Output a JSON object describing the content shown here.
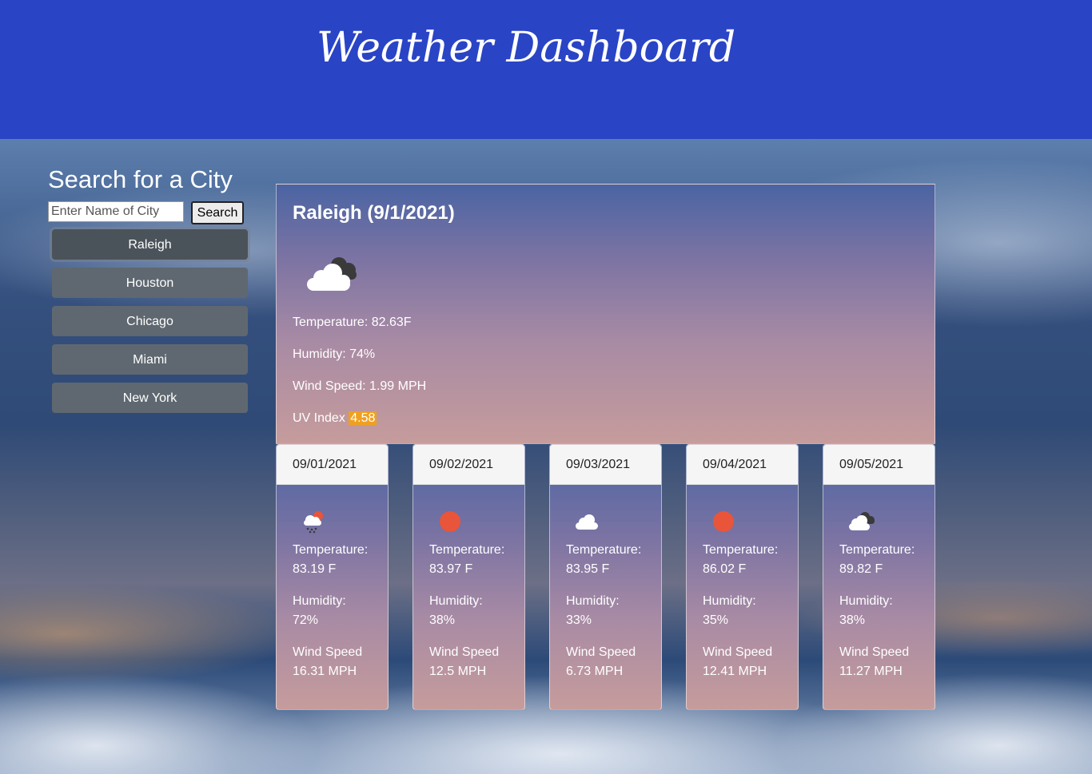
{
  "header": {
    "title": "Weather Dashboard"
  },
  "search": {
    "title": "Search for a City",
    "placeholder": "Enter Name of City",
    "button_label": "Search"
  },
  "cities": [
    "Raleigh",
    "Houston",
    "Chicago",
    "Miami",
    "New York"
  ],
  "current": {
    "heading": "Raleigh (9/1/2021)",
    "icon": "broken-clouds-icon",
    "temperature": "Temperature: 82.63F",
    "humidity": "Humidity: 74%",
    "wind": "Wind Speed: 1.99 MPH",
    "uv_label": "UV Index",
    "uv_value": "4.58",
    "uv_color": "#f0a020"
  },
  "forecast": [
    {
      "date": "09/01/2021",
      "icon": "rain-snow-icon",
      "temp_label": "Temperature:",
      "temp": "83.19 F",
      "hum_label": "Humidity:",
      "hum": "72%",
      "wind_label": "Wind Speed",
      "wind": "16.31 MPH"
    },
    {
      "date": "09/02/2021",
      "icon": "sun-icon",
      "temp_label": "Temperature:",
      "temp": "83.97 F",
      "hum_label": "Humidity:",
      "hum": "38%",
      "wind_label": "Wind Speed",
      "wind": "12.5 MPH"
    },
    {
      "date": "09/03/2021",
      "icon": "cloud-icon",
      "temp_label": "Temperature:",
      "temp": "83.95 F",
      "hum_label": "Humidity:",
      "hum": "33%",
      "wind_label": "Wind Speed",
      "wind": "6.73 MPH"
    },
    {
      "date": "09/04/2021",
      "icon": "sun-icon",
      "temp_label": "Temperature:",
      "temp": "86.02 F",
      "hum_label": "Humidity:",
      "hum": "35%",
      "wind_label": "Wind Speed",
      "wind": "12.41 MPH"
    },
    {
      "date": "09/05/2021",
      "icon": "broken-clouds-icon",
      "temp_label": "Temperature:",
      "temp": "89.82 F",
      "hum_label": "Humidity:",
      "hum": "38%",
      "wind_label": "Wind Speed",
      "wind": "11.27 MPH"
    }
  ]
}
